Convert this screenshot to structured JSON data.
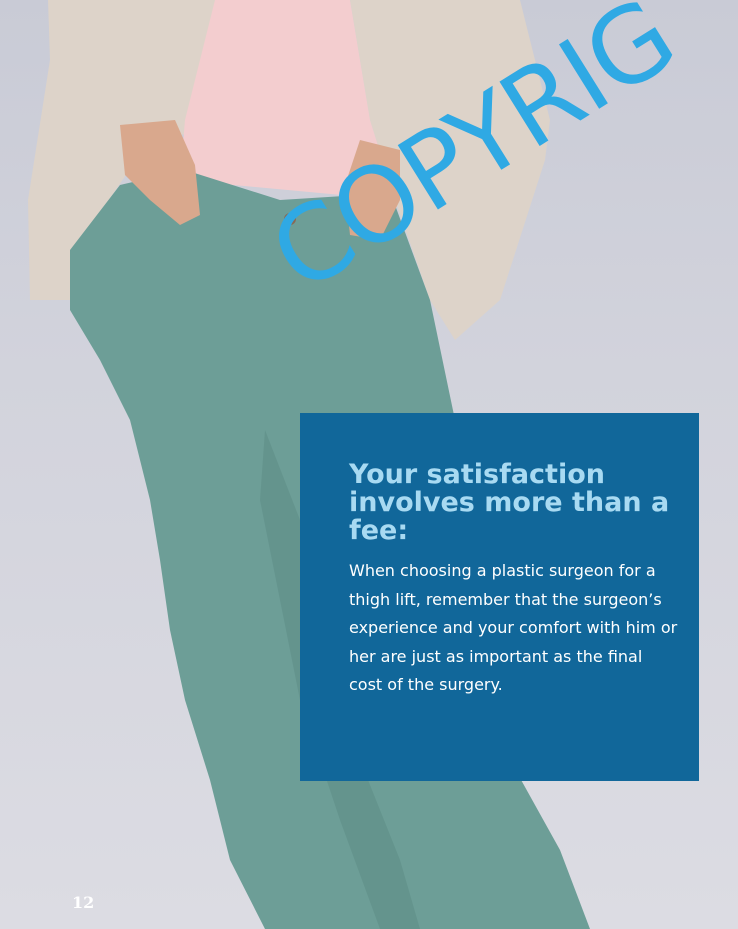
{
  "callout": {
    "heading": "Your satisfaction involves more than a fee:",
    "body": "When choosing a plastic surgeon for a thigh lift, remember that the surgeon’s experience and your comfort with him or her are just as important as the final cost of the surgery."
  },
  "watermark": "COPYRIG",
  "page_number": "12",
  "colors": {
    "callout_bg": "#11679a",
    "heading": "#a8daf2",
    "watermark": "#2fa9e4",
    "jeans": "#6d9e97",
    "blazer": "#ddd3c9",
    "blouse": "#f3cdcf"
  }
}
